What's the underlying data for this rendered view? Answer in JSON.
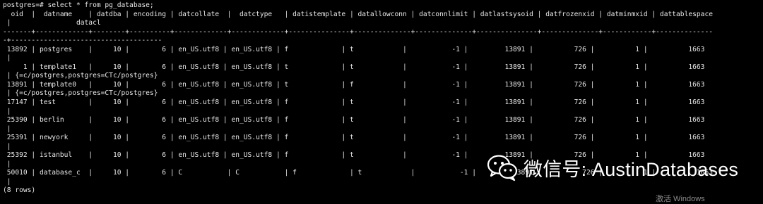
{
  "terminal": {
    "background": "#000000",
    "foreground": "#e8e8e8",
    "lines": [
      "postgres=# select * from pg_database;",
      "  oid  |  datname    | datdba | encoding | datcollate  |  datctype   | datistemplate | datallowconn | datconnlimit | datlastsysoid | datfrozenxid | datminmxid | dattablespace",
      " |                datacl",
      "-------+-------------+--------+----------+-------------+-------------+---------------+--------------+--------------+---------------+--------------+------------+--------------",
      "-+-------------------------------------",
      " 13892 | postgres    |     10 |        6 | en_US.utf8 | en_US.utf8 | f             | t            |           -1 |         13891 |          726 |          1 |          1663",
      " |",
      "     1 | template1   |     10 |        6 | en_US.utf8 | en_US.utf8 | t             | t            |           -1 |         13891 |          726 |          1 |          1663",
      " | {=c/postgres,postgres=CTc/postgres}",
      " 13891 | template0   |     10 |        6 | en_US.utf8 | en_US.utf8 | t             | f            |           -1 |         13891 |          726 |          1 |          1663",
      " | {=c/postgres,postgres=CTc/postgres}",
      " 17147 | test        |     10 |        6 | en_US.utf8 | en_US.utf8 | f             | t            |           -1 |         13891 |          726 |          1 |          1663",
      " |",
      " 25390 | berlin      |     10 |        6 | en_US.utf8 | en_US.utf8 | f             | t            |           -1 |         13891 |          726 |          1 |          1663",
      " |",
      " 25391 | newyork     |     10 |        6 | en_US.utf8 | en_US.utf8 | f             | t            |           -1 |         13891 |          726 |          1 |          1663",
      " |",
      " 25392 | istanbul    |     10 |        6 | en_US.utf8 | en_US.utf8 | f             | t            |           -1 |         13891 |          726 |          1 |          1663",
      " |",
      " 50010 | database_c  |     10 |        6 | C           | C           | f             | t            |           -1 |         13891 |          726 |          1 |          1663",
      " |",
      "(8 rows)"
    ]
  },
  "watermark": {
    "text": "微信号: AustinDatabases",
    "icon": "wechat-icon",
    "color": "#ffffff"
  },
  "os_overlay": {
    "activate_text": "激活 Windows"
  }
}
